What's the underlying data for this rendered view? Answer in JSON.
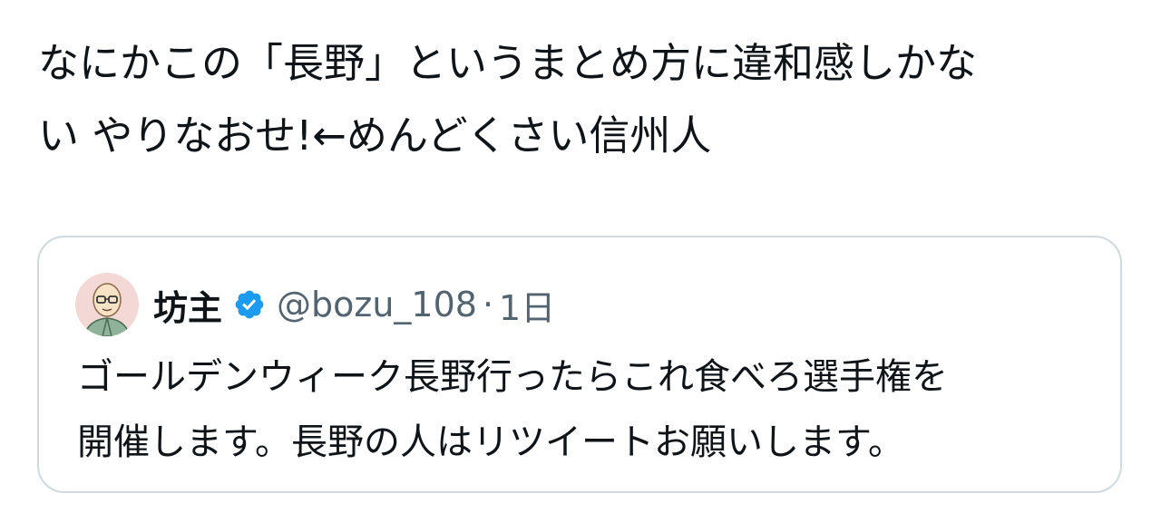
{
  "tweet": {
    "text_lines": [
      "なにかこの「長野」というまとめ方に違和感しかな",
      "い やりなおせ!←めんどくさい信州人"
    ]
  },
  "quoted_tweet": {
    "author_name": "坊主",
    "verified_icon": "verified-badge-icon",
    "handle": "@bozu_108",
    "separator": "·",
    "time": "1日",
    "text_lines": [
      "ゴールデンウィーク長野行ったらこれ食べろ選手権を",
      "開催します。長野の人はリツイートお願いします。"
    ]
  },
  "colors": {
    "text_primary": "#0f1419",
    "text_secondary": "#536471",
    "card_border": "#cfd9de",
    "verified_blue": "#1d9bf0"
  }
}
